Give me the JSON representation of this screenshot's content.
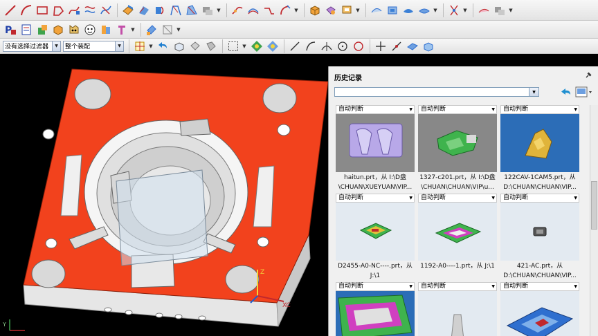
{
  "toolbar3": {
    "filter_value": "没有选择过滤器",
    "scope_value": "整个装配"
  },
  "history_panel": {
    "title": "历史记录",
    "combo_value": ""
  },
  "cards": [
    {
      "label": "自动判断",
      "caption_line1": "haitun.prt，从 I:\\D盘",
      "caption_line2": "\\CHUAN\\XUEYUAN\\VIP...",
      "thumb": "purple"
    },
    {
      "label": "自动判断",
      "caption_line1": "1327-c201.prt，从 I:\\D盘",
      "caption_line2": "\\CHUAN\\CHUAN\\VIP\\u...",
      "thumb": "gray"
    },
    {
      "label": "自动判断",
      "caption_line1": "122CAV-1CAM5.prt，从",
      "caption_line2": "D:\\CHUAN\\CHUAN\\VIP...",
      "thumb": "blue"
    },
    {
      "label": "自动判断",
      "caption_line1": "D2455-A0-NC----.prt，从",
      "caption_line2": "J:\\1",
      "thumb": "light"
    },
    {
      "label": "自动判断",
      "caption_line1": "1192-A0----1.prt，从 J:\\1",
      "caption_line2": "",
      "thumb": "light"
    },
    {
      "label": "自动判断",
      "caption_line1": "421-AC.prt，从",
      "caption_line2": "D:\\CHUAN\\CHUAN\\VIP...",
      "thumb": "light"
    },
    {
      "label": "自动判断",
      "caption_line1": "",
      "caption_line2": "",
      "thumb": "blue2"
    },
    {
      "label": "自动判断",
      "caption_line1": "",
      "caption_line2": "",
      "thumb": "light"
    },
    {
      "label": "自动判断",
      "caption_line1": "",
      "caption_line2": "",
      "thumb": "light"
    }
  ],
  "viewport": {
    "axis_z": "Z",
    "axis_x": "XC",
    "axis_corner": "Y"
  },
  "colors": {
    "plate": "#f2421d",
    "plate_side": "#d9d9d9",
    "thumb_blue": "#2c6db7",
    "thumb_light": "#e3eaf1"
  }
}
